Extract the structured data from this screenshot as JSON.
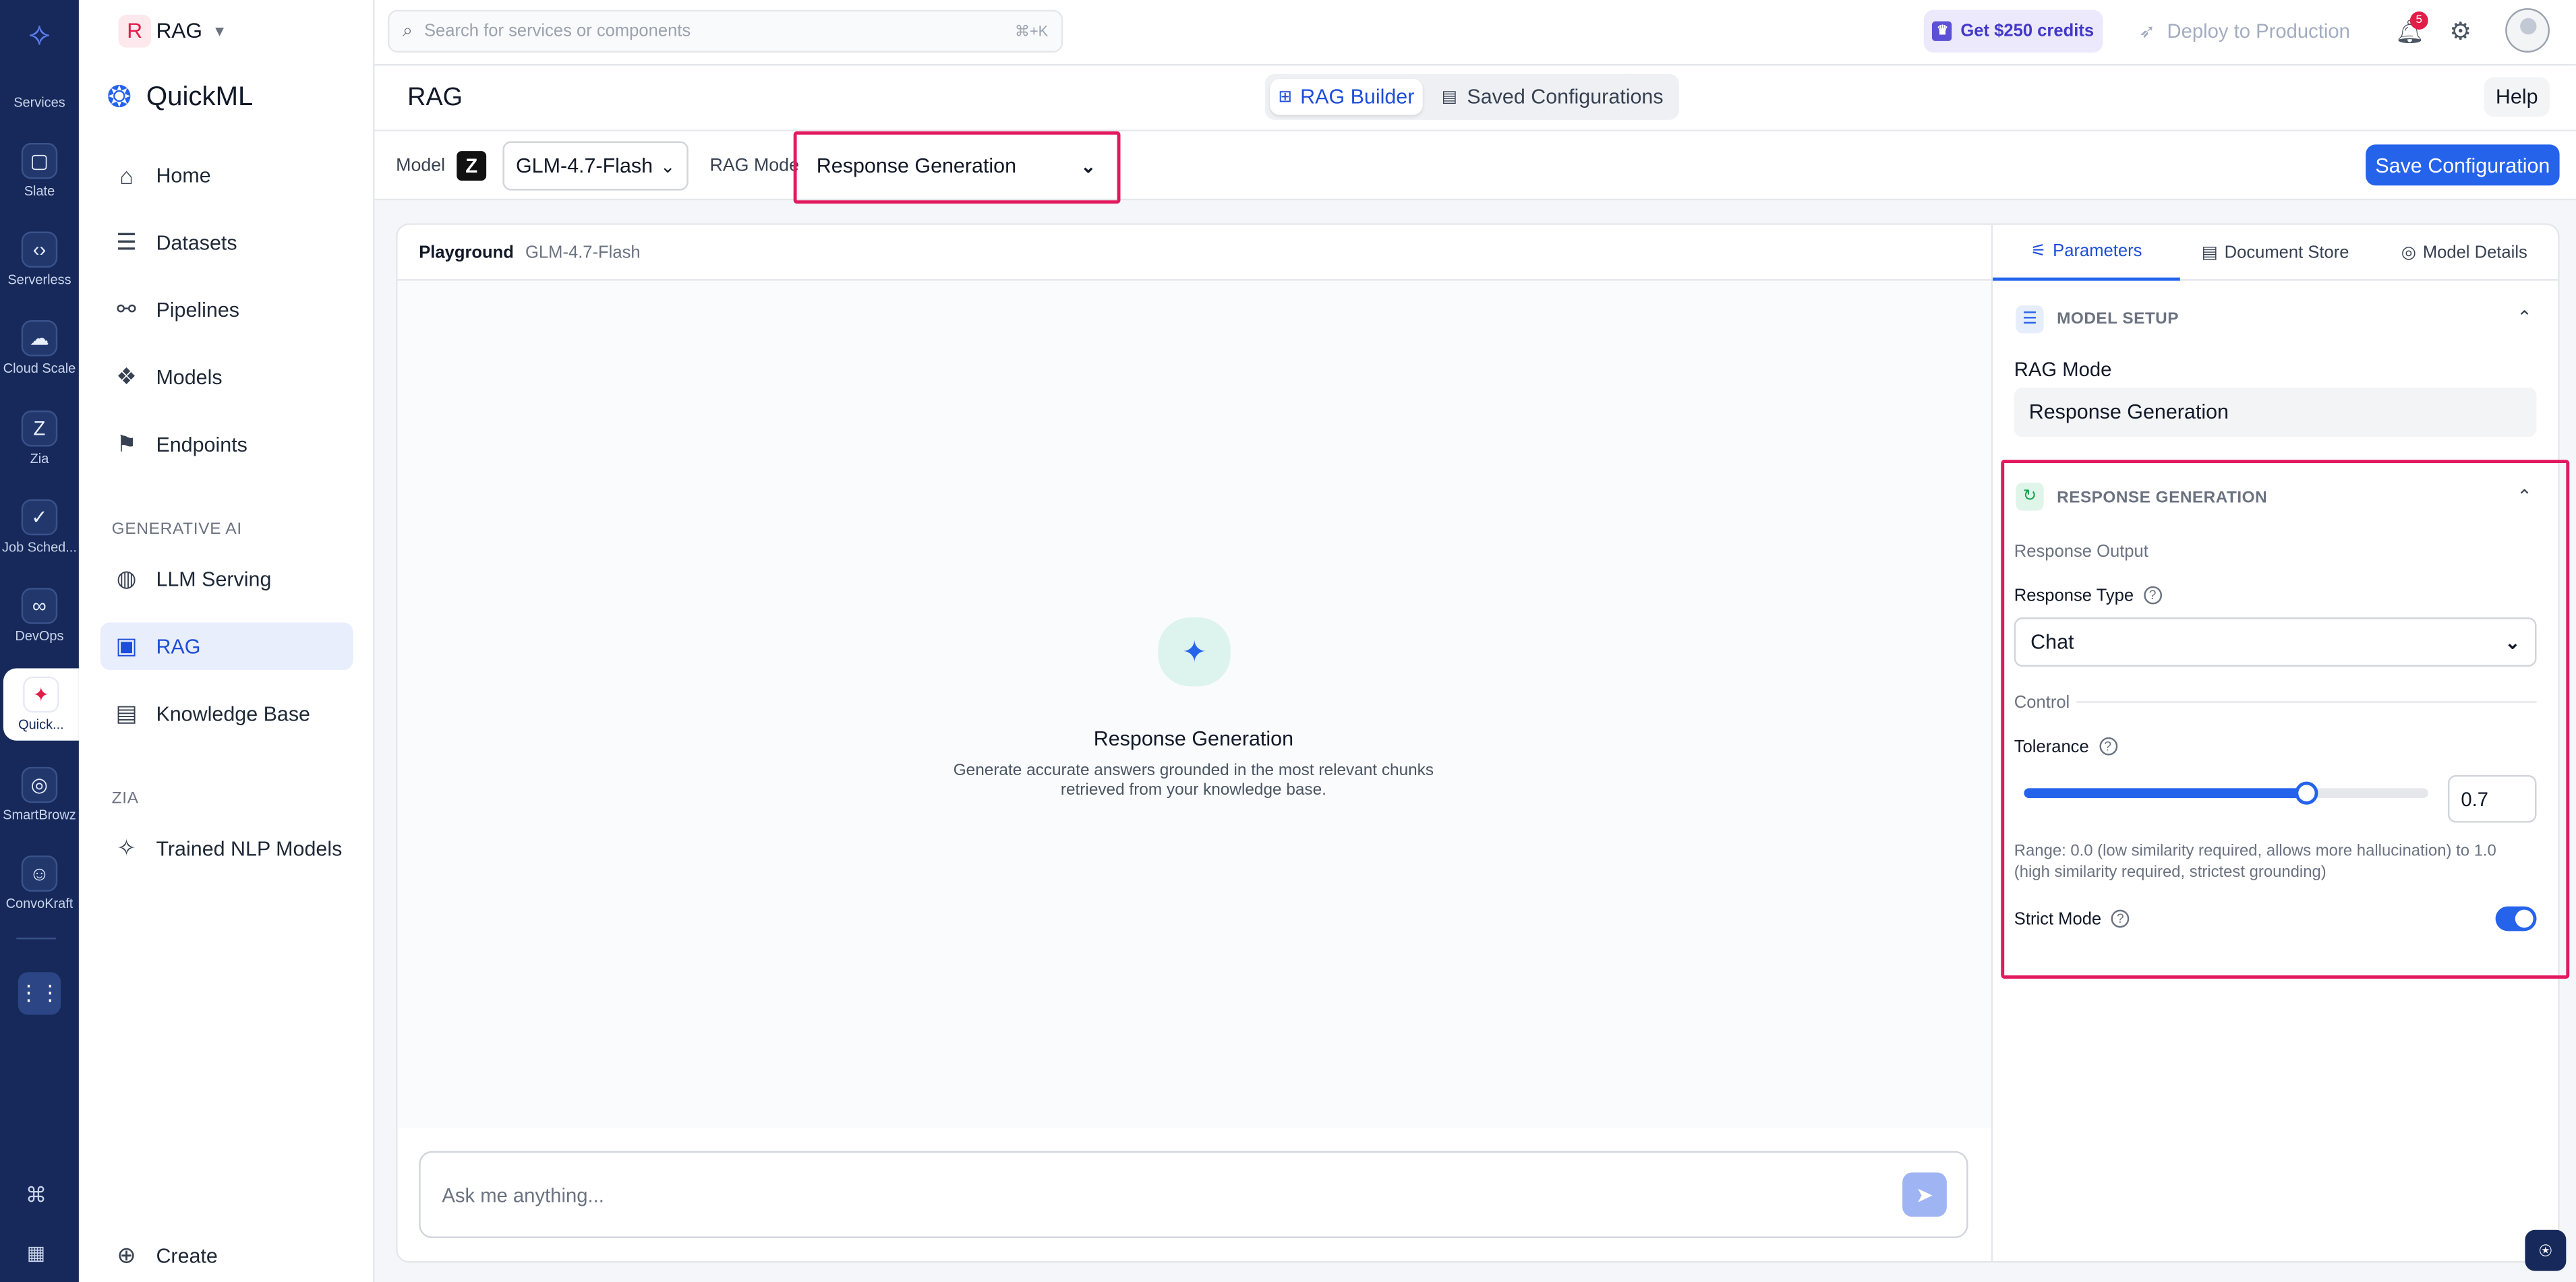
{
  "rail": {
    "items": [
      {
        "label": "Services",
        "icon": "services-logo-icon"
      },
      {
        "label": "Slate",
        "icon": "slate-icon"
      },
      {
        "label": "Serverless",
        "icon": "serverless-icon"
      },
      {
        "label": "Cloud Scale",
        "icon": "cloud-scale-icon"
      },
      {
        "label": "Zia",
        "icon": "zia-icon"
      },
      {
        "label": "Job Sched...",
        "icon": "job-scheduling-icon"
      },
      {
        "label": "DevOps",
        "icon": "devops-icon"
      },
      {
        "label": "Quick...",
        "icon": "quickml-icon"
      },
      {
        "label": "SmartBrowz",
        "icon": "smartbrowz-icon"
      },
      {
        "label": "ConvoKraft",
        "icon": "convokraft-icon"
      }
    ]
  },
  "project": {
    "badge": "R",
    "name": "RAG"
  },
  "search": {
    "placeholder": "Search for services or components",
    "shortcut": "⌘+K"
  },
  "header": {
    "credits": "Get $250 credits",
    "deploy": "Deploy to Production",
    "notif_count": "5"
  },
  "sidebar": {
    "app_title": "QuickML",
    "items": [
      {
        "label": "Home"
      },
      {
        "label": "Datasets"
      },
      {
        "label": "Pipelines"
      },
      {
        "label": "Models"
      },
      {
        "label": "Endpoints"
      }
    ],
    "gen_ai_label": "GENERATIVE AI",
    "gen_items": [
      {
        "label": "LLM Serving"
      },
      {
        "label": "RAG"
      },
      {
        "label": "Knowledge Base"
      }
    ],
    "zia_label": "ZIA",
    "zia_items": [
      {
        "label": "Trained NLP Models"
      }
    ],
    "create": "Create"
  },
  "page": {
    "title": "RAG",
    "tabs": [
      {
        "label": "RAG Builder"
      },
      {
        "label": "Saved Configurations"
      }
    ],
    "help": "Help"
  },
  "toolbar": {
    "model_label": "Model",
    "model_value": "GLM-4.7-Flash",
    "rag_mode_label": "RAG Mode",
    "rag_mode_value": "Response Generation",
    "save": "Save Configuration"
  },
  "playground": {
    "title": "Playground",
    "model": "GLM-4.7-Flash",
    "empty_title": "Response Generation",
    "empty_desc_1": "Generate accurate answers grounded in the most relevant chunks",
    "empty_desc_2": "retrieved from your knowledge base.",
    "input_placeholder": "Ask me anything..."
  },
  "panel": {
    "tabs": [
      {
        "label": "Parameters"
      },
      {
        "label": "Document Store"
      },
      {
        "label": "Model Details"
      }
    ],
    "model_setup": {
      "heading": "MODEL SETUP",
      "rag_mode_label": "RAG Mode",
      "rag_mode_value": "Response Generation"
    },
    "response_generation": {
      "heading": "RESPONSE GENERATION",
      "output_label": "Response Output",
      "response_type_label": "Response Type",
      "response_type_value": "Chat",
      "control_label": "Control",
      "tolerance_label": "Tolerance",
      "tolerance_value": "0.7",
      "tolerance_fraction": 0.7,
      "range_note_1": "Range: 0.0 (low similarity required, allows more hallucination) to 1.0",
      "range_note_2": "(high similarity required, strictest grounding)",
      "strict_mode_label": "Strict Mode",
      "strict_mode_on": true
    }
  },
  "colors": {
    "accent": "#2563eb",
    "highlight": "#e3195e",
    "rail": "#16295a"
  }
}
